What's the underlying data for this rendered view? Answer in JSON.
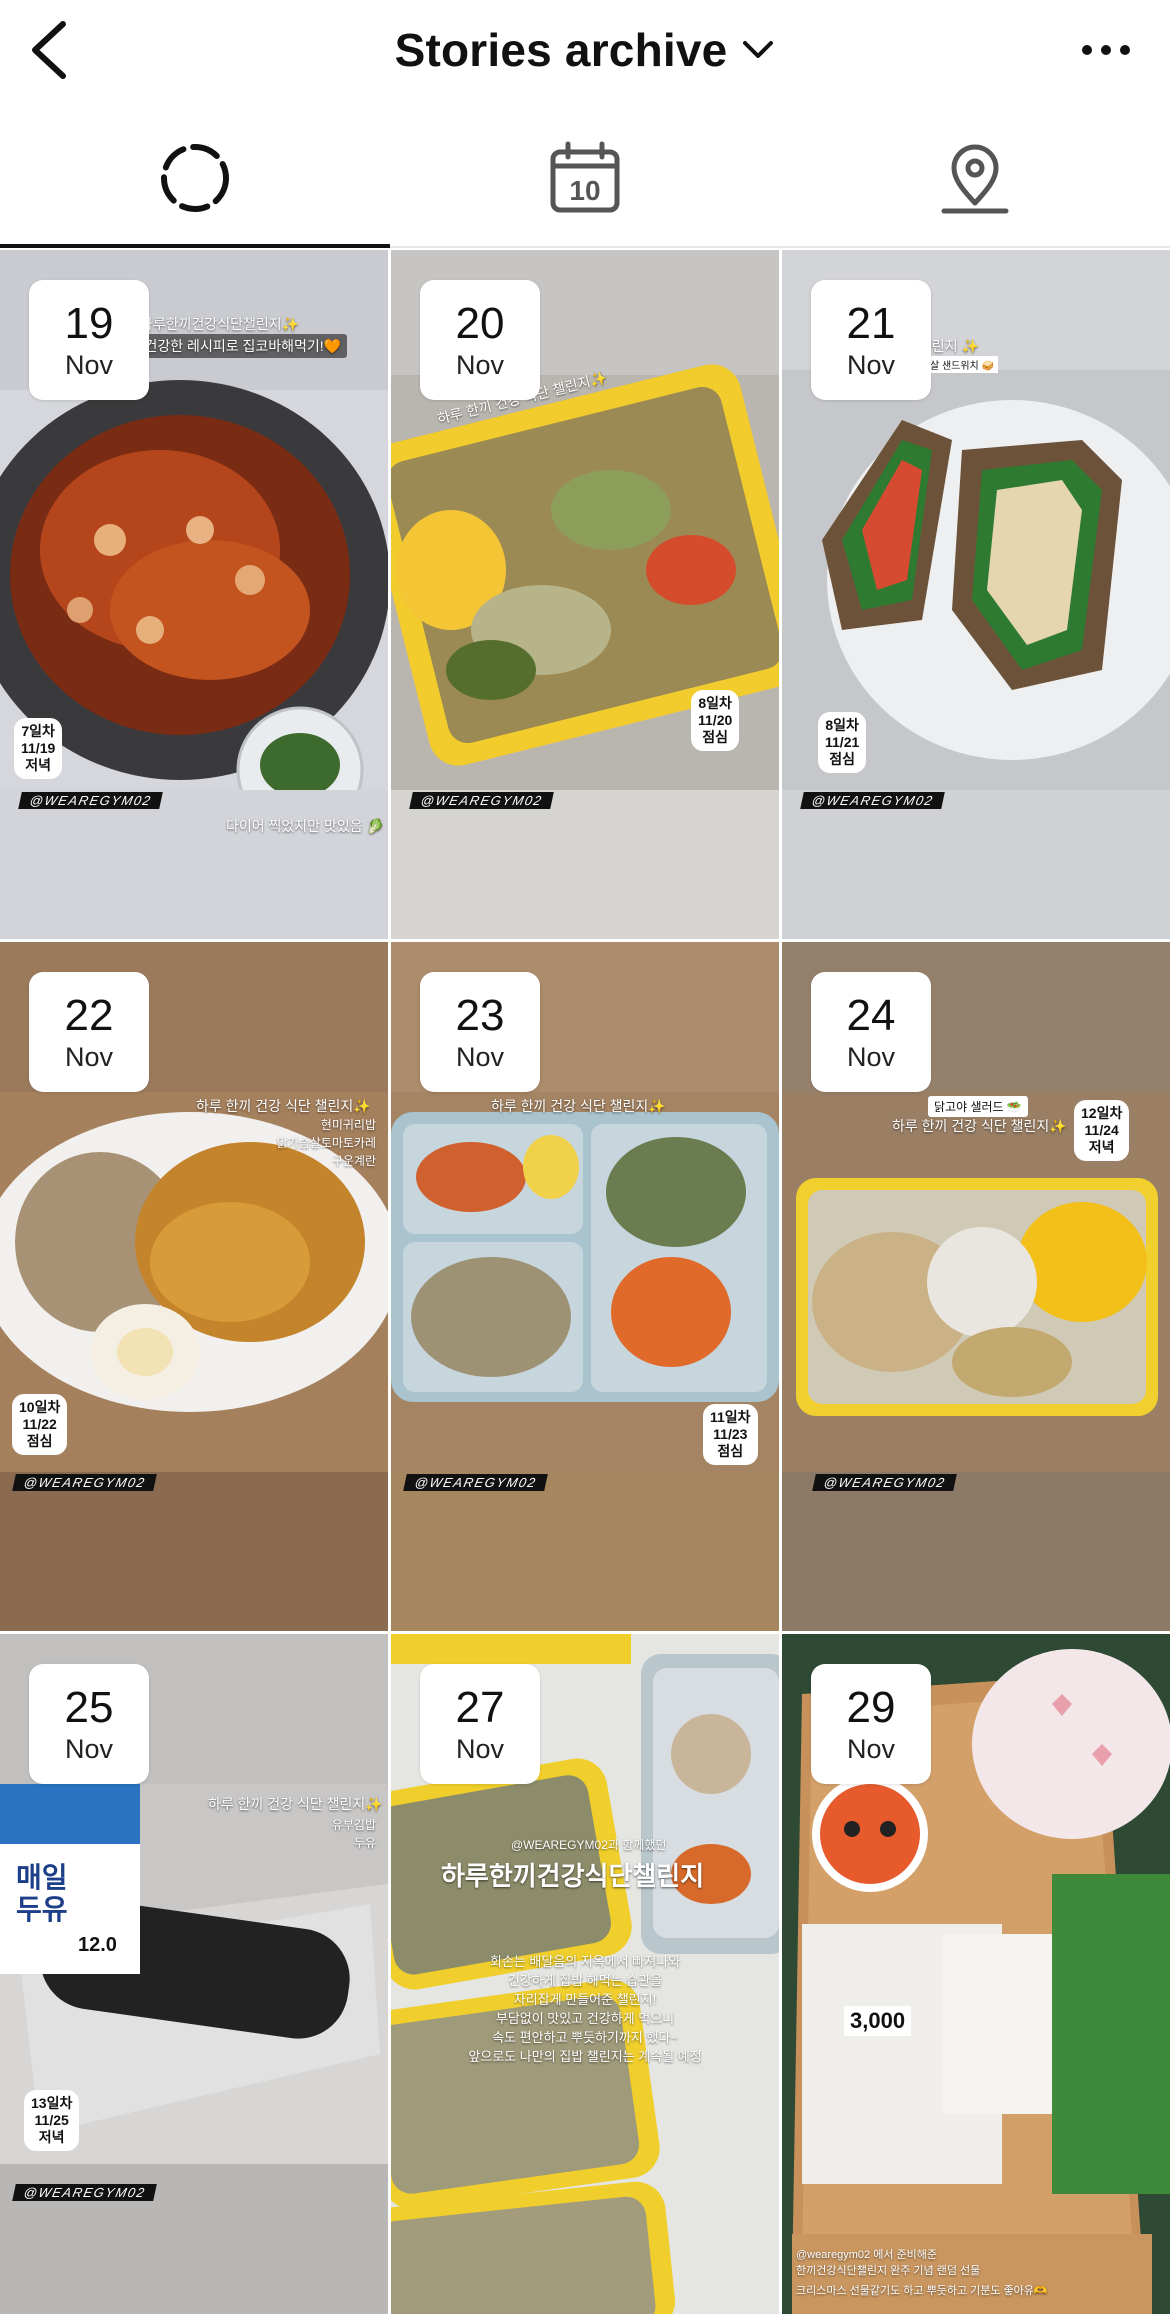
{
  "header": {
    "title": "Stories archive"
  },
  "tabs": [
    {
      "name": "stories",
      "icon": "stories-circle-icon",
      "active": true
    },
    {
      "name": "calendar",
      "icon": "calendar-icon",
      "calendar_day": "10",
      "active": false
    },
    {
      "name": "map",
      "icon": "location-pin-icon",
      "active": false
    }
  ],
  "stories": [
    {
      "day": "19",
      "month": "Nov",
      "title": "하루한끼건강식단챌린지✨",
      "subtitle": "오늘은 건강한 레시피로 집코바해먹기!🧡",
      "caption": "다이어 찍었지만 맛있음 🥬",
      "tag": [
        "7일차",
        "11/19",
        "저녁"
      ],
      "handle": "@WEAREGYM02"
    },
    {
      "day": "20",
      "month": "Nov",
      "title": "하루 한끼 건강 식단 챌린지✨",
      "subtitle": "",
      "caption": "",
      "tag": [
        "8일차",
        "11/20",
        "점심"
      ],
      "handle": "@WEAREGYM02"
    },
    {
      "day": "21",
      "month": "Nov",
      "title": "하루한끼건강식단 챌린지 ✨",
      "subtitle": "홈메이드크랜베리 닭가슴살 샌드위치 🥪",
      "caption": "",
      "tag": [
        "8일차",
        "11/21",
        "점심"
      ],
      "handle": "@WEAREGYM02"
    },
    {
      "day": "22",
      "month": "Nov",
      "title": "하루 한끼 건강 식단 챌린지✨",
      "subtitle": "현미귀리밥",
      "subtitle2": "닭가슴살토마토카레",
      "subtitle3": "구운계란",
      "caption": "",
      "tag": [
        "10일차",
        "11/22",
        "점심"
      ],
      "handle": "@WEAREGYM02"
    },
    {
      "day": "23",
      "month": "Nov",
      "title": "하루 한끼 건강 식단 챌린지✨",
      "subtitle": "",
      "caption": "",
      "tag": [
        "11일차",
        "11/23",
        "점심"
      ],
      "handle": "@WEAREGYM02"
    },
    {
      "day": "24",
      "month": "Nov",
      "title": "하루 한끼 건강 식단 챌린지✨",
      "subtitle": "닭고야 샐러드 🥗",
      "caption": "",
      "tag": [
        "12일차",
        "11/24",
        "저녁"
      ],
      "handle": "@WEAREGYM02"
    },
    {
      "day": "25",
      "month": "Nov",
      "title": "하루 한끼 건강 식단 챌린지✨",
      "subtitle": "유부김밥",
      "subtitle2": "두유",
      "caption": "",
      "tag": [
        "13일차",
        "11/25",
        "저녁"
      ],
      "handle": "@WEAREGYM02",
      "product_line1": "매일",
      "product_line2": "두유",
      "product_protein": "12.0"
    },
    {
      "day": "27",
      "month": "Nov",
      "title": "하루한끼건강식단챌린지",
      "subtitle": "@WEAREGYM02과 함께했던",
      "body": [
        "회손는 배달음의 지옥에서 빠져나와",
        "건강하게 집밥 해먹는 습관을",
        "자리잡게 만들어준 챌린지!",
        "부담없이 맛있고 건강하게 먹으니",
        "속도 편안하고 뿌듯하기까지 했다~",
        "앞으로도 나만의 집밥 챌린지는 계속될 예정"
      ],
      "caption": "",
      "tag": [],
      "handle": ""
    },
    {
      "day": "29",
      "month": "Nov",
      "title": "",
      "subtitle": "@wearegym02 에서 준비해준",
      "body": [
        "한끼건강식단챌린지 완주 기념 랜덤 선물",
        "크리스마스 선물같기도 하고 뿌듯하고 기분도 좋아유🫶"
      ],
      "price": "3,000",
      "caption": "",
      "tag": [],
      "handle": ""
    }
  ],
  "colors": {
    "background": "#ffffff",
    "text": "#111111",
    "divider": "#e6e6e6",
    "badge_bg": "#ffffff"
  }
}
